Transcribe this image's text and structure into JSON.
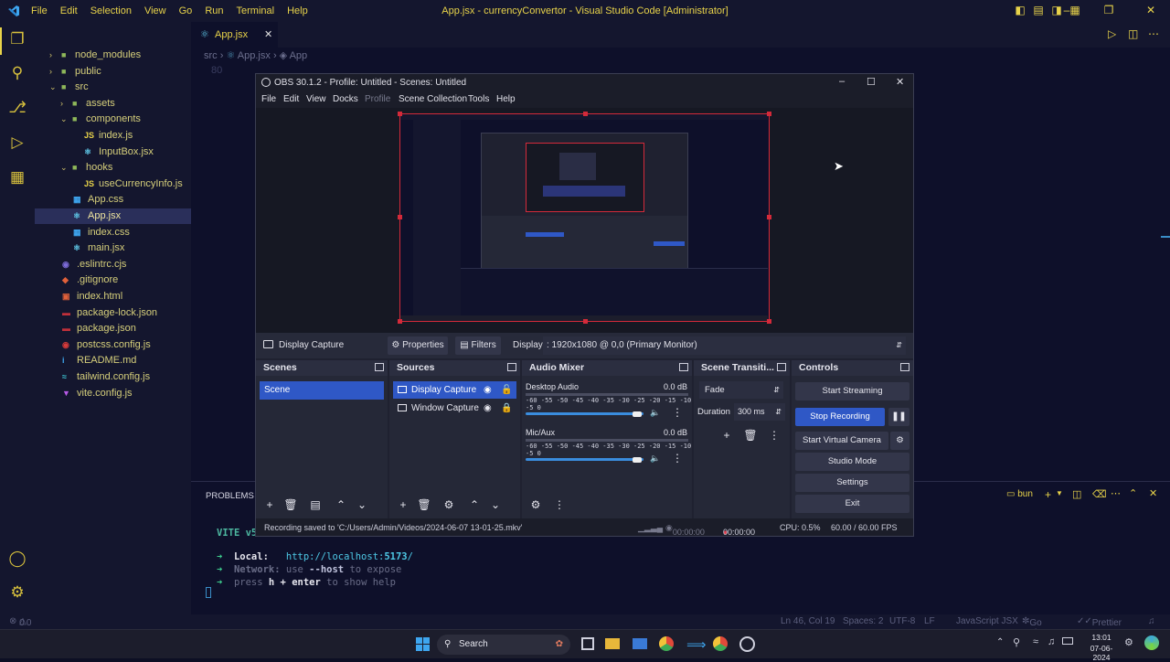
{
  "vscode": {
    "window_title": "App.jsx - currencyConvertor - Visual Studio Code [Administrator]",
    "menu": [
      "File",
      "Edit",
      "Selection",
      "View",
      "Go",
      "Run",
      "Terminal",
      "Help"
    ],
    "tab": "App.jsx",
    "breadcrumb": {
      "src": "src",
      "file": "App.jsx",
      "symbol": "App"
    },
    "line_number": "80",
    "explorer": [
      {
        "label": "node_modules",
        "icon": "folder"
      },
      {
        "label": "public",
        "icon": "folder"
      },
      {
        "label": "src",
        "icon": "folder-open"
      },
      {
        "label": "assets",
        "icon": "folder"
      },
      {
        "label": "components",
        "icon": "folder-open"
      },
      {
        "label": "index.js",
        "icon": "JS"
      },
      {
        "label": "InputBox.jsx",
        "icon": "react"
      },
      {
        "label": "hooks",
        "icon": "folder-open"
      },
      {
        "label": "useCurrencyInfo.js",
        "icon": "JS"
      },
      {
        "label": "App.css",
        "icon": "css"
      },
      {
        "label": "App.jsx",
        "icon": "react"
      },
      {
        "label": "index.css",
        "icon": "css"
      },
      {
        "label": "main.jsx",
        "icon": "react"
      },
      {
        "label": ".eslintrc.cjs",
        "icon": "eslint"
      },
      {
        "label": ".gitignore",
        "icon": "git"
      },
      {
        "label": "index.html",
        "icon": "html"
      },
      {
        "label": "package-lock.json",
        "icon": "npm"
      },
      {
        "label": "package.json",
        "icon": "npm"
      },
      {
        "label": "postcss.config.js",
        "icon": "postcss"
      },
      {
        "label": "README.md",
        "icon": "info"
      },
      {
        "label": "tailwind.config.js",
        "icon": "tailwind"
      },
      {
        "label": "vite.config.js",
        "icon": "vite"
      }
    ],
    "panel": {
      "tab": "PROBLEMS",
      "shell": "bun",
      "vite": "VITE v5",
      "local_label": "Local:",
      "local_url_prefix": "http://localhost:",
      "local_port": "5173",
      "local_slash": "/",
      "network_label": "Network:",
      "network_use": "use",
      "network_flag": "--host",
      "network_rest": "to expose",
      "press": "press",
      "key": "h + enter",
      "help": "to show help"
    },
    "status": {
      "errors": "0",
      "warnings": "0",
      "position": "Ln 46, Col 19",
      "spaces": "Spaces: 2",
      "encoding": "UTF-8",
      "eol": "LF",
      "language": "JavaScript JSX",
      "golive": "Go Live",
      "prettier": "Prettier"
    }
  },
  "obs": {
    "title": "OBS 30.1.2 - Profile: Untitled - Scenes: Untitled",
    "menu": [
      "File",
      "Edit",
      "View",
      "Docks",
      "Profile",
      "Scene Collection",
      "Tools",
      "Help"
    ],
    "source_bar": {
      "source": "Display Capture",
      "properties": "Properties",
      "filters": "Filters",
      "display_label": "Display",
      "display_value": ": 1920x1080 @ 0,0 (Primary Monitor)"
    },
    "scenes": {
      "title": "Scenes",
      "items": [
        "Scene"
      ]
    },
    "sources": {
      "title": "Sources",
      "items": [
        "Display Capture",
        "Window Capture"
      ]
    },
    "mixer": {
      "title": "Audio Mixer",
      "channels": [
        {
          "name": "Desktop Audio",
          "db": "0.0 dB",
          "level": 0.92
        },
        {
          "name": "Mic/Aux",
          "db": "0.0 dB",
          "level": 0.92
        }
      ],
      "scale": "-60 -55 -50 -45 -40 -35 -30 -25 -20 -15 -10 -5 0"
    },
    "transitions": {
      "title": "Scene Transiti...",
      "type": "Fade",
      "duration_label": "Duration",
      "duration": "300 ms"
    },
    "controls": {
      "title": "Controls",
      "start_streaming": "Start Streaming",
      "stop_recording": "Stop Recording",
      "start_virtual_camera": "Start Virtual Camera",
      "studio_mode": "Studio Mode",
      "settings": "Settings",
      "exit": "Exit"
    },
    "status": {
      "message": "Recording saved to 'C:/Users/Admin/Videos/2024-06-07 13-01-25.mkv'",
      "stream_time": "00:00:00",
      "rec_time": "00:00:00",
      "cpu": "CPU: 0.5%",
      "fps": "60.00 / 60.00 FPS"
    }
  },
  "taskbar": {
    "search": "Search",
    "time": "13:01",
    "date": "07-06-2024"
  },
  "colors": {
    "accent_yellow": "#e8d34a",
    "obs_blue": "#2f58c6",
    "record_red": "#e03a4a"
  }
}
